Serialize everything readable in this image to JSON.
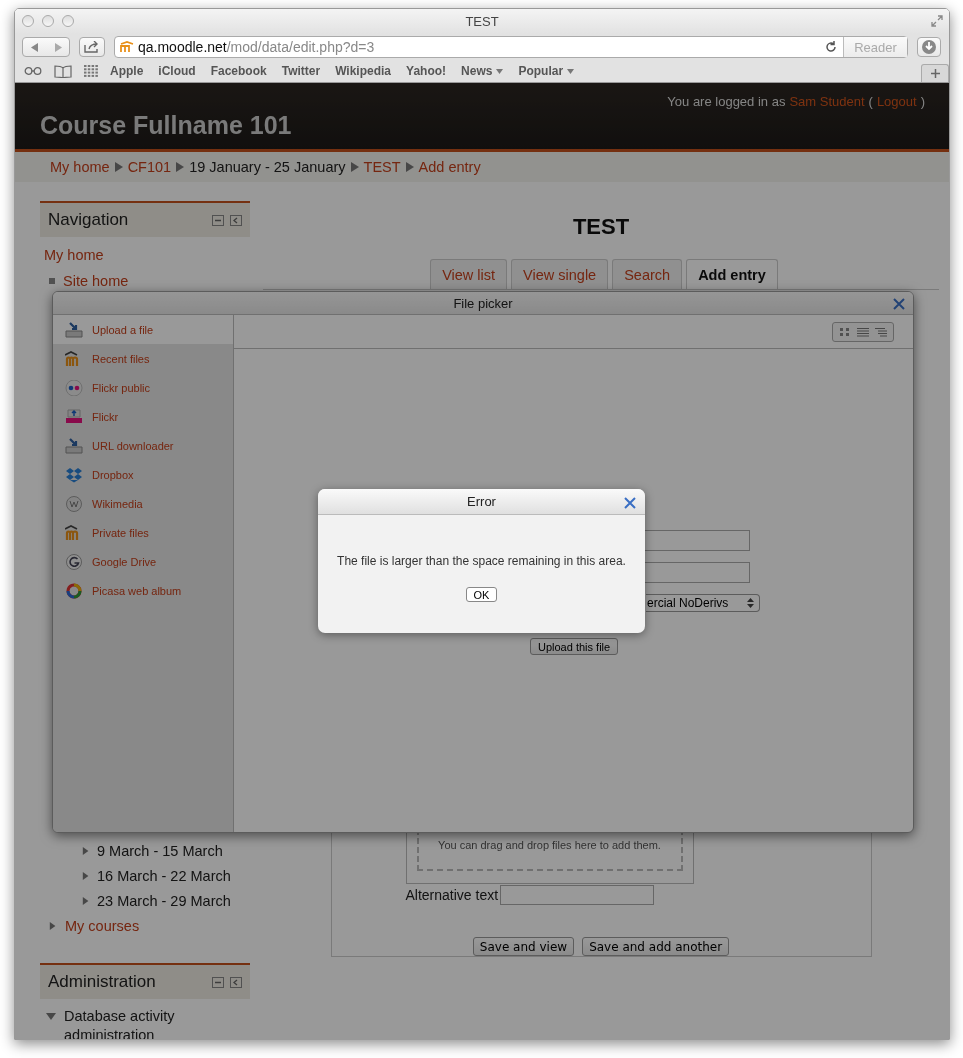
{
  "browser": {
    "title": "TEST",
    "url_host": "qa.moodle.net",
    "url_path": "/mod/data/edit.php?d=3",
    "reader": "Reader",
    "bookmarks": [
      {
        "label": "Apple",
        "kind": "link"
      },
      {
        "label": "iCloud",
        "kind": "link"
      },
      {
        "label": "Facebook",
        "kind": "link"
      },
      {
        "label": "Twitter",
        "kind": "link"
      },
      {
        "label": "Wikipedia",
        "kind": "link"
      },
      {
        "label": "Yahoo!",
        "kind": "link"
      },
      {
        "label": "News",
        "kind": "menu"
      },
      {
        "label": "Popular",
        "kind": "menu"
      }
    ]
  },
  "header": {
    "course": "Course Fullname 101",
    "login_text": "You are logged in as",
    "user_link": "Sam Student",
    "paren_open": "(",
    "logout_link": "Logout",
    "paren_close": ")"
  },
  "breadcrumb": [
    {
      "label": "My home",
      "link": true
    },
    {
      "label": "CF101",
      "link": true
    },
    {
      "label": "19 January - 25 January",
      "link": false
    },
    {
      "label": "TEST",
      "link": true
    },
    {
      "label": "Add entry",
      "link": true
    }
  ],
  "navigation": {
    "title": "Navigation",
    "items": [
      {
        "label": "My home",
        "kind": "link"
      },
      {
        "label": "Site home",
        "kind": "bullet"
      }
    ],
    "weeks": [
      {
        "label": "9 March - 15 March",
        "expanded": false
      },
      {
        "label": "16 March - 22 March",
        "expanded": false
      },
      {
        "label": "23 March - 29 March",
        "expanded": false
      }
    ],
    "my_courses": {
      "label": "My courses",
      "expanded": false
    }
  },
  "activity": {
    "title": "TEST",
    "tabs": [
      {
        "label": "View list",
        "selected": false
      },
      {
        "label": "View single",
        "selected": false
      },
      {
        "label": "Search",
        "selected": false
      },
      {
        "label": "Add entry",
        "selected": true
      }
    ]
  },
  "form": {
    "dropzone_hint": "You can drag and drop files here to add them.",
    "alt_label": "Alternative text",
    "buttons": [
      "Save and view",
      "Save and add another"
    ]
  },
  "administration": {
    "title": "Administration",
    "items": [
      {
        "label": "Database activity administration",
        "expanded": true
      }
    ]
  },
  "file_picker": {
    "title": "File picker",
    "repositories": [
      {
        "label": "Upload a file",
        "kind": "upload",
        "selected": true
      },
      {
        "label": "Recent files",
        "kind": "moodle",
        "selected": false
      },
      {
        "label": "Flickr public",
        "kind": "flickr-public",
        "selected": false
      },
      {
        "label": "Flickr",
        "kind": "flickr",
        "selected": false
      },
      {
        "label": "URL downloader",
        "kind": "upload",
        "selected": false
      },
      {
        "label": "Dropbox",
        "kind": "dropbox",
        "selected": false
      },
      {
        "label": "Wikimedia",
        "kind": "wikimedia",
        "selected": false
      },
      {
        "label": "Private files",
        "kind": "moodle",
        "selected": false
      },
      {
        "label": "Google Drive",
        "kind": "google",
        "selected": false
      },
      {
        "label": "Picasa web album",
        "kind": "picasa",
        "selected": false
      }
    ],
    "license_visible": "ercial NoDerivs",
    "upload_button": "Upload this file"
  },
  "error_dialog": {
    "title": "Error",
    "message": "The file is larger than the space remaining in this area.",
    "ok": "OK"
  }
}
